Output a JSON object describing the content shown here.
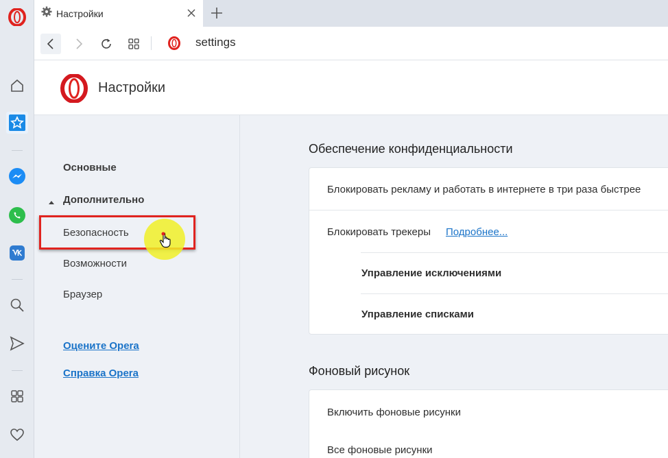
{
  "tab": {
    "title": "Настройки",
    "icon": "gear-icon"
  },
  "address": {
    "url": "settings"
  },
  "header": {
    "title": "Настройки"
  },
  "sidebar_icons": [
    "opera-logo-icon",
    "home-icon",
    "speed-dial-icon",
    "messenger-icon",
    "whatsapp-icon",
    "vk-icon",
    "search-icon",
    "send-icon",
    "apps-icon",
    "heart-icon"
  ],
  "nav": {
    "basic": "Основные",
    "advanced": "Дополнительно",
    "security": "Безопасность",
    "features": "Возможности",
    "browser": "Браузер",
    "rate": "Оцените Opera",
    "help": "Справка Opera"
  },
  "privacy": {
    "title": "Обеспечение конфиденциальности",
    "block_ads": "Блокировать рекламу и работать в интернете в три раза быстрее",
    "block_trackers": "Блокировать трекеры",
    "more_link": "Подробнее...",
    "manage_exceptions": "Управление исключениями",
    "manage_lists": "Управление списками"
  },
  "wallpaper": {
    "title": "Фоновый рисунок",
    "enable": "Включить фоновые рисунки",
    "all": "Все фоновые рисунки"
  },
  "colors": {
    "accent": "#1a73c8",
    "opera_red": "#e0231f",
    "highlight": "#f0f028"
  }
}
